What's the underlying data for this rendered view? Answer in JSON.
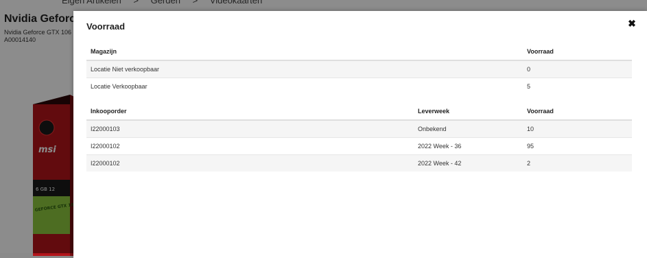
{
  "background": {
    "breadcrumb": [
      "Eigen Artikelen",
      ">",
      "Gerden",
      ">",
      "Videokaarten"
    ],
    "product_title": "Nvidia Geforce",
    "product_subtitle": "Nvidia Geforce GTX 106",
    "product_code": "A00014140",
    "box_brand": "msi",
    "box_model": "GEFORCE GTX 1060"
  },
  "modal": {
    "title": "Voorraad",
    "close_symbol": "✖",
    "stock_table": {
      "headers": [
        "Magazijn",
        "Voorraad"
      ],
      "rows": [
        [
          "Locatie Niet verkoopbaar",
          "0"
        ],
        [
          "Locatie Verkoopbaar",
          "5"
        ]
      ]
    },
    "orders_table": {
      "headers": [
        "Inkooporder",
        "Leverweek",
        "Voorraad"
      ],
      "rows": [
        [
          "I22000103",
          "Onbekend",
          "10"
        ],
        [
          "I22000102",
          "2022 Week - 36",
          "95"
        ],
        [
          "I22000102",
          "2022 Week - 42",
          "2"
        ]
      ]
    }
  },
  "colors": {
    "overlay": "#000000",
    "row_stripe": "#f5f5f5",
    "box_red": "#b3151b",
    "box_green": "#8cc63f"
  }
}
